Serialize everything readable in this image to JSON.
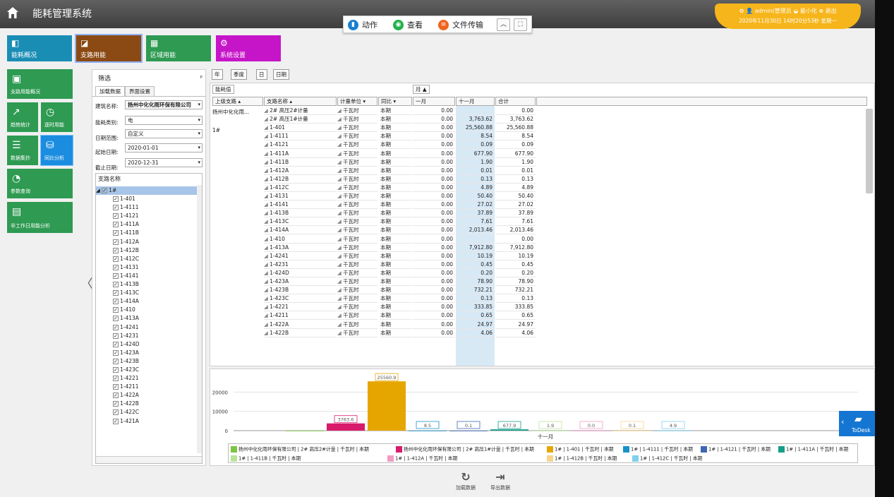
{
  "header": {
    "title": "能耗管理系统",
    "user": "admin(管理员",
    "minimize": "最小化",
    "logout": "退出",
    "datetime": "2020年11月30日 14时20分53秒 星期一"
  },
  "remote": {
    "action": "动作",
    "view": "查看",
    "file": "文件传输"
  },
  "nav": [
    {
      "label": "能耗概况",
      "color": "#1a8db5"
    },
    {
      "label": "支路用能",
      "color": "#8b4a13"
    },
    {
      "label": "区域用能",
      "color": "#2e9a52"
    },
    {
      "label": "系统设置",
      "color": "#c615c9"
    }
  ],
  "sidenav": [
    "支路用能概况",
    "趋势统计",
    "逐时用能",
    "数据集抄",
    "同比分析",
    "参数查询",
    "非工作日用能分析"
  ],
  "filter": {
    "title": "筛选",
    "tab_load": "加载数据",
    "tab_ui": "界面设置",
    "building_label": "建筑名称:",
    "building_value": "扬州中化化雨环保有限公司",
    "category_label": "能耗类别:",
    "category_value": "电",
    "range_label": "日期范围:",
    "range_value": "自定义",
    "start_label": "起始日期:",
    "start_value": "2020-01-01",
    "end_label": "截止日期:",
    "end_value": "2020-12-31",
    "tree_header": "支路名称",
    "tree_root": "1#",
    "tree": [
      "1-401",
      "1-4111",
      "1-4121",
      "1-411A",
      "1-411B",
      "1-412A",
      "1-412B",
      "1-412C",
      "1-4131",
      "1-4141",
      "1-413B",
      "1-413C",
      "1-414A",
      "1-410",
      "1-413A",
      "1-4241",
      "1-4231",
      "1-424D",
      "1-423A",
      "1-423B",
      "1-423C",
      "1-4221",
      "1-4211",
      "1-422A",
      "1-422B",
      "1-422C",
      "1-421A"
    ]
  },
  "period_tabs": [
    "年",
    "季度",
    "日",
    "日期"
  ],
  "grid": {
    "value_label": "能耗值",
    "month_filter": "月 ▲",
    "headers": [
      "上级支路",
      "支路名称",
      "计量单位",
      "同比",
      "一月",
      "十一月",
      "合计"
    ],
    "parent_a": "扬州中化化雨...",
    "parent_b": "1#",
    "unit": "千瓦时",
    "period": "本期",
    "rows": [
      [
        "2# 高压2#计量",
        "0.00",
        "",
        "0.00"
      ],
      [
        "2# 高压1#计量",
        "0.00",
        "3,763.62",
        "3,763.62"
      ],
      [
        "1-401",
        "0.00",
        "25,560.88",
        "25,560.88"
      ],
      [
        "1-4111",
        "0.00",
        "8.54",
        "8.54"
      ],
      [
        "1-4121",
        "0.00",
        "0.09",
        "0.09"
      ],
      [
        "1-411A",
        "0.00",
        "677.90",
        "677.90"
      ],
      [
        "1-411B",
        "0.00",
        "1.90",
        "1.90"
      ],
      [
        "1-412A",
        "0.00",
        "0.01",
        "0.01"
      ],
      [
        "1-412B",
        "0.00",
        "0.13",
        "0.13"
      ],
      [
        "1-412C",
        "0.00",
        "4.89",
        "4.89"
      ],
      [
        "1-4131",
        "0.00",
        "50.40",
        "50.40"
      ],
      [
        "1-4141",
        "0.00",
        "27.02",
        "27.02"
      ],
      [
        "1-413B",
        "0.00",
        "37.89",
        "37.89"
      ],
      [
        "1-413C",
        "0.00",
        "7.61",
        "7.61"
      ],
      [
        "1-414A",
        "0.00",
        "2,013.46",
        "2,013.46"
      ],
      [
        "1-410",
        "0.00",
        "",
        "0.00"
      ],
      [
        "1-413A",
        "0.00",
        "7,912.80",
        "7,912.80"
      ],
      [
        "1-4241",
        "0.00",
        "10.19",
        "10.19"
      ],
      [
        "1-4231",
        "0.00",
        "0.45",
        "0.45"
      ],
      [
        "1-424D",
        "0.00",
        "0.20",
        "0.20"
      ],
      [
        "1-423A",
        "0.00",
        "78.90",
        "78.90"
      ],
      [
        "1-423B",
        "0.00",
        "732.21",
        "732.21"
      ],
      [
        "1-423C",
        "0.00",
        "0.13",
        "0.13"
      ],
      [
        "1-4221",
        "0.00",
        "333.85",
        "333.85"
      ],
      [
        "1-4211",
        "0.00",
        "0.65",
        "0.65"
      ],
      [
        "1-422A",
        "0.00",
        "24.97",
        "24.97"
      ],
      [
        "1-422B",
        "0.00",
        "4.06",
        "4.06"
      ]
    ]
  },
  "chart_data": {
    "type": "bar",
    "categories": [
      "十一月"
    ],
    "ylim": [
      0,
      30000
    ],
    "yticks": [
      0,
      10000,
      20000
    ],
    "series": [
      {
        "name": "扬州中化化雨环保有限公司 | 2# 高压2#计量 | 千瓦时 | 本期",
        "value": 0,
        "label": "",
        "color": "#7cc442"
      },
      {
        "name": "扬州中化化雨环保有限公司 | 2# 高压1#计量 | 千瓦时 | 本期",
        "value": 3763.6,
        "label": "3763.6",
        "color": "#d81b6a"
      },
      {
        "name": "1# | 1-401 | 千瓦时 | 本期",
        "value": 25560.9,
        "label": "25560.9",
        "color": "#e6a600"
      },
      {
        "name": "1# | 1-4111 | 千瓦时 | 本期",
        "value": 8.5,
        "label": "8.5",
        "color": "#1793c8"
      },
      {
        "name": "1# | 1-4121 | 千瓦时 | 本期",
        "value": 0.1,
        "label": "0.1",
        "color": "#3e66b6"
      },
      {
        "name": "1# | 1-411A | 千瓦时 | 本期",
        "value": 677.9,
        "label": "677.9",
        "color": "#179e8a"
      },
      {
        "name": "1# | 1-411B | 千瓦时 | 本期",
        "value": 1.9,
        "label": "1.9",
        "color": "#b9e39a"
      },
      {
        "name": "1# | 1-412A | 千瓦时 | 本期",
        "value": 0.0,
        "label": "0.0",
        "color": "#f29cc3"
      },
      {
        "name": "1# | 1-412B | 千瓦时 | 本期",
        "value": 0.1,
        "label": "0.1",
        "color": "#f6d58e"
      },
      {
        "name": "1# | 1-412C | 千瓦时 | 本期",
        "value": 4.9,
        "label": "4.9",
        "color": "#7fd0ee"
      }
    ]
  },
  "bottom": {
    "load": "加载数据",
    "export": "导出数据"
  },
  "todesk": "ToDesk"
}
